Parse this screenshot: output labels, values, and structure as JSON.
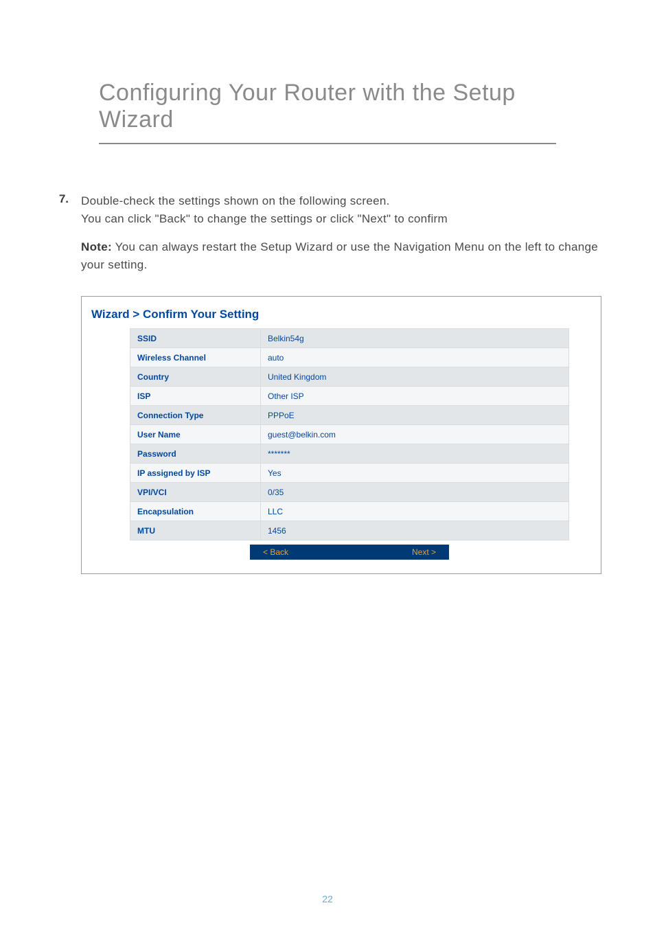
{
  "page_title": "Configuring Your Router with the Setup Wizard",
  "step_number": "7.",
  "step_text_line1": "Double-check the settings shown on the following screen.",
  "step_text_line2": "You can click \"Back\" to change the settings or click \"Next\" to confirm",
  "note_label": "Note:",
  "note_text": " You can always restart the Setup Wizard or use the Navigation Menu on the left to change your setting.",
  "breadcrumb": "Wizard > Confirm Your Setting",
  "settings": [
    {
      "label": "SSID",
      "value": "Belkin54g"
    },
    {
      "label": "Wireless Channel",
      "value": "auto"
    },
    {
      "label": "Country",
      "value": "United Kingdom"
    },
    {
      "label": "ISP",
      "value": "Other ISP"
    },
    {
      "label": "Connection Type",
      "value": "PPPoE"
    },
    {
      "label": "User Name",
      "value": "guest@belkin.com"
    },
    {
      "label": "Password",
      "value": "*******"
    },
    {
      "label": "IP assigned by ISP",
      "value": "Yes"
    },
    {
      "label": "VPI/VCI",
      "value": "0/35"
    },
    {
      "label": "Encapsulation",
      "value": "LLC"
    },
    {
      "label": "MTU",
      "value": "1456"
    }
  ],
  "buttons": {
    "back": "< Back",
    "next": "Next >"
  },
  "page_number": "22"
}
